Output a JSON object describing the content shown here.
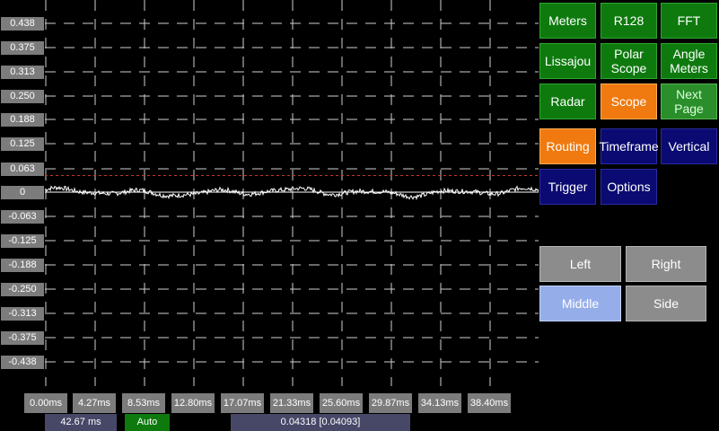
{
  "y_axis_labels": [
    "0.438",
    "0.375",
    "0.313",
    "0.250",
    "0.188",
    "0.125",
    "0.063",
    "0",
    "-0.063",
    "-0.125",
    "-0.188",
    "-0.250",
    "-0.313",
    "-0.375",
    "-0.438"
  ],
  "x_axis_labels": [
    "0.00ms",
    "4.27ms",
    "8.53ms",
    "12.80ms",
    "17.07ms",
    "21.33ms",
    "25.60ms",
    "29.87ms",
    "34.13ms",
    "38.40ms"
  ],
  "status": {
    "timeframe": "42.67 ms",
    "trigger_mode": "Auto",
    "level_readout": "0.04318 [0.04093]"
  },
  "buttons": {
    "meters": "Meters",
    "r128": "R128",
    "fft": "FFT",
    "lissajou": "Lissajou",
    "polar_scope": "Polar Scope",
    "angle_meters": "Angle Meters",
    "radar": "Radar",
    "scope": "Scope",
    "next_page": "Next Page",
    "routing": "Routing",
    "timeframe": "Timeframe",
    "vertical": "Vertical",
    "trigger": "Trigger",
    "options": "Options",
    "left": "Left",
    "right": "Right",
    "middle": "Middle",
    "side": "Side"
  },
  "colors": {
    "green": "#0e7a0e",
    "orange": "#f07a10",
    "navy": "#0a0a72",
    "gray": "#8c8c8c",
    "light_blue": "#95aeea",
    "waveform": "#ffffff",
    "trigger_line": "#c0392b"
  },
  "trigger_level": 0.043
}
